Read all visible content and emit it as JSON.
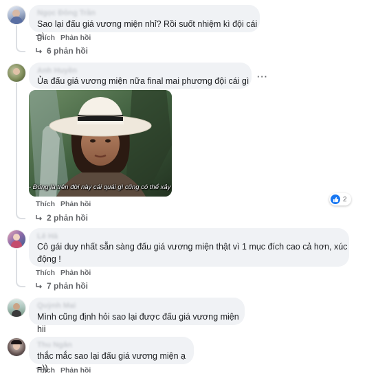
{
  "comments": [
    {
      "author": "Ngọc Đông Trần",
      "text": "Sao lại đấu giá vương miện nhỉ? Rồi suốt nhiệm kì đội cái gì",
      "like_label": "Thích",
      "reply_label": "Phản hồi",
      "replies_label": "6 phản hồi"
    },
    {
      "author": "Anh Huyền",
      "text": "Ủa đấu giá vương miện nữa final mai phương đội cái gì ??",
      "media_caption": "- Đúng là trên đời này cái quái gì cũng có thể xảy ra!",
      "like_label": "Thích",
      "reply_label": "Phản hồi",
      "reaction_count": "2",
      "replies_label": "2 phản hồi",
      "more_label": "···"
    },
    {
      "author": "Lê Hà",
      "text_line1": "Cô gái duy nhất sẵn sàng đấu giá vương miện thật vì 1 mục đích cao cả hơn, xúc",
      "text_line2": "động !",
      "like_label": "Thích",
      "reply_label": "Phản hồi",
      "replies_label": "7 phản hồi"
    },
    {
      "author": "Quỳnh Mai",
      "text": "Mình cũng định hỏi sao lại được đấu giá vương miện hii",
      "like_label": "Thích",
      "reply_label": "Phản hồi"
    },
    {
      "author": "Thu Ngân",
      "text": "thắc mắc sao lại đấu giá vương miện ạ =))",
      "like_label": "Thích",
      "reply_label": "Phản hồi"
    }
  ],
  "colors": {
    "bubble": "#f0f2f5",
    "meta": "#65676b",
    "like_blue": "#1877f2"
  }
}
